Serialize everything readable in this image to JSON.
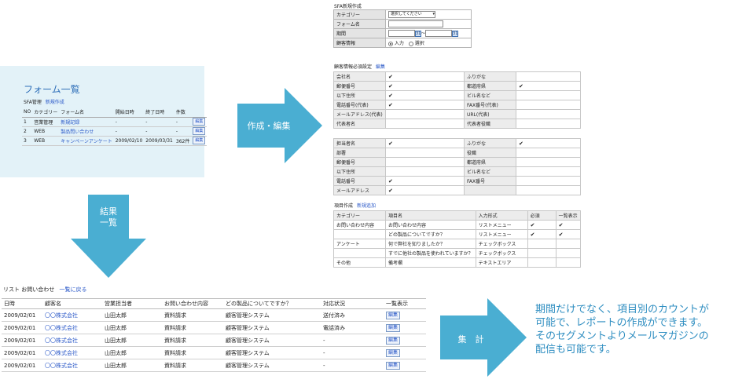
{
  "form_list": {
    "title": "フォーム一覧",
    "header_label": "SFA管理",
    "new_link": "新規作成",
    "columns": [
      "NO",
      "カテゴリー",
      "フォーム名",
      "開始日時",
      "終了日時",
      "件数"
    ],
    "rows": [
      {
        "no": "1",
        "category": "営業管理",
        "name": "新規記録",
        "start": "-",
        "end": "-",
        "count": "-",
        "action": "編集"
      },
      {
        "no": "2",
        "category": "WEB",
        "name": "製品問い合わせ",
        "start": "-",
        "end": "-",
        "count": "-",
        "action": "編集"
      },
      {
        "no": "3",
        "category": "WEB",
        "name": "キャンペーンアンケート",
        "start": "2009/02/10",
        "end": "2009/03/31",
        "count": "362件",
        "action": "編集"
      }
    ]
  },
  "arrows": {
    "create_edit": "作成・編集",
    "results_line1": "結果",
    "results_line2": "一覧",
    "aggregate": "集　計"
  },
  "sfa_form": {
    "title": "SFA新規作成",
    "category_label": "カテゴリー",
    "category_value": "選択してください",
    "form_name_label": "フォーム名",
    "period_label": "期間",
    "period_sep": "〜",
    "customer_label": "顧客情報",
    "radio_input": "入力",
    "radio_select": "選択"
  },
  "customer_required": {
    "title": "顧客情報必須設定",
    "edit_link": "編集",
    "rows": [
      [
        "会社名",
        "✔",
        "ふりがな",
        ""
      ],
      [
        "郵便番号",
        "✔",
        "都道府県",
        "✔"
      ],
      [
        "以下住所",
        "✔",
        "ビル名など",
        ""
      ],
      [
        "電話番号(代表)",
        "✔",
        "FAX番号(代表)",
        ""
      ],
      [
        "メールアドレス(代表)",
        "",
        "URL(代表)",
        ""
      ],
      [
        "代表者名",
        "",
        "代表者役職",
        ""
      ]
    ]
  },
  "contact_required": {
    "rows": [
      [
        "担当者名",
        "✔",
        "ふりがな",
        "✔"
      ],
      [
        "部署",
        "",
        "役職",
        ""
      ],
      [
        "郵便番号",
        "",
        "都道府県",
        ""
      ],
      [
        "以下住所",
        "",
        "ビル名など",
        ""
      ],
      [
        "電話番号",
        "✔",
        "FAX番号",
        ""
      ],
      [
        "メールアドレス",
        "✔",
        "",
        ""
      ]
    ]
  },
  "item_create": {
    "title": "項目作成",
    "add_link": "新規追加",
    "columns": [
      "カテゴリー",
      "項目名",
      "入力形式",
      "必須",
      "一覧表示"
    ],
    "rows": [
      [
        "お問い合わせ内容",
        "お問い合わせ内容",
        "リストメニュー",
        "✔",
        "✔"
      ],
      [
        "",
        "どの製品についてですか？",
        "リストメニュー",
        "✔",
        "✔"
      ],
      [
        "アンケート",
        "何で弊社を知りましたか？",
        "チェックボックス",
        "",
        ""
      ],
      [
        "",
        "すでに他社の製品を使われていますか？",
        "チェックボックス",
        "",
        ""
      ],
      [
        "その他",
        "備考欄",
        "テキストエリア",
        "",
        ""
      ]
    ]
  },
  "result_list": {
    "title": "リスト  お問い合わせ",
    "back_link": "一覧に戻る",
    "columns": [
      "日時",
      "顧客名",
      "営業担当者",
      "お問い合わせ内容",
      "どの製品についてですか？",
      "対応状況",
      "一覧表示"
    ],
    "rows": [
      [
        "2009/02/01",
        "〇〇株式会社",
        "山田太郎",
        "資料請求",
        "顧客管理システム",
        "送付済み",
        "編集"
      ],
      [
        "2009/02/01",
        "〇〇株式会社",
        "山田太郎",
        "資料請求",
        "顧客管理システム",
        "電話済み",
        "編集"
      ],
      [
        "2009/02/01",
        "〇〇株式会社",
        "山田太郎",
        "資料請求",
        "顧客管理システム",
        "-",
        "編集"
      ],
      [
        "2009/02/01",
        "〇〇株式会社",
        "山田太郎",
        "資料請求",
        "顧客管理システム",
        "-",
        "編集"
      ],
      [
        "2009/02/01",
        "〇〇株式会社",
        "山田太郎",
        "資料請求",
        "顧客管理システム",
        "-",
        "編集"
      ]
    ]
  },
  "summary": {
    "line1": "期間だけでなく、項目別のカウントが",
    "line2": "可能で、レポートの作成ができます。",
    "line3": "そのセグメントよりメールマガジンの",
    "line4": "配信も可能です。"
  },
  "colors": {
    "arrow": "#4aaed2",
    "panel_bg": "#e3f2f8",
    "link": "#2a58c8",
    "summary_text": "#2f8ec1"
  }
}
